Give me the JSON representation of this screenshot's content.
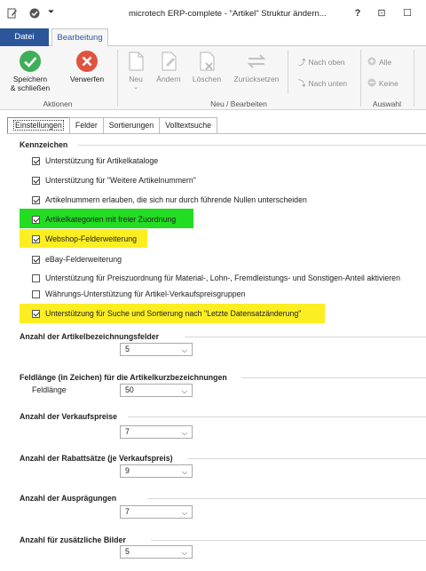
{
  "window": {
    "title": "microtech ERP-complete - \"Artikel\" Struktur ändern...",
    "help_glyph": "?",
    "restore_glyph": "⊡",
    "max_glyph": "☐"
  },
  "ribbon_tabs": [
    "Datei",
    "Bearbeitung"
  ],
  "ribbon": {
    "aktionen": {
      "label": "Aktionen",
      "save_line1": "Speichern",
      "save_line2": "& schließen",
      "discard": "Verwerfen"
    },
    "neu_bearbeiten": {
      "label": "Neu / Bearbeiten",
      "neu": "Neu",
      "aendern": "Ändern",
      "loeschen": "Löschen",
      "zuruecksetzen": "Zurücksetzen",
      "nach_oben": "Nach oben",
      "nach_unten": "Nach unten"
    },
    "auswahl": {
      "label": "Auswahl",
      "alle": "Alle",
      "keine": "Keine"
    }
  },
  "content_tabs": [
    "Einstellungen",
    "Felder",
    "Sortierungen",
    "Volltextsuche"
  ],
  "kennzeichen": {
    "title": "Kennzeichen",
    "items": [
      {
        "label": "Unterstützung für Artikelkataloge",
        "checked": true
      },
      {
        "label": "Unterstützung für \"Weitere Artikelnummern\"",
        "checked": true
      },
      {
        "label": "Artikelnummern erlauben, die sich nur durch führende Nullen unterscheiden",
        "checked": true
      },
      {
        "label": "Artikelkategorien mit freier Zuordnung",
        "checked": true
      },
      {
        "label": "Webshop-Felderweiterung",
        "checked": true
      },
      {
        "label": "eBay-Felderweiterung",
        "checked": true
      },
      {
        "label": "Unterstützung für Preiszuordnung für Material-, Lohn-, Fremdleistungs- und Sonstigen-Anteil aktivieren",
        "checked": false
      },
      {
        "label": "Währungs-Unterstützung für Artikel-Verkaufspreisgruppen",
        "checked": false
      },
      {
        "label": "Unterstützung für Suche und Sortierung nach \"Letzte Datensatzänderung\"",
        "checked": true
      }
    ]
  },
  "settings": [
    {
      "title": "Anzahl der Artikelbezeichnungsfelder",
      "field_label": "",
      "value": "5"
    },
    {
      "title": "Feldlänge (in Zeichen) für die Artikelkurzbezeichnungen",
      "field_label": "Feldlänge",
      "value": "50"
    },
    {
      "title": "Anzahl der Verkaufspreise",
      "field_label": "",
      "value": "7"
    },
    {
      "title": "Anzahl der Rabattsätze (je Verkaufspreis)",
      "field_label": "",
      "value": "9"
    },
    {
      "title": "Anzahl der Ausprägungen",
      "field_label": "",
      "value": "7"
    },
    {
      "title": "Anzahl für zusätzliche Bilder",
      "field_label": "",
      "value": "5"
    }
  ],
  "colors": {
    "accent": "#2b579a",
    "highlight_green": "#22dd22",
    "highlight_yellow": "#fcee21",
    "save_green": "#3fae5a",
    "discard_red": "#e0533f"
  }
}
